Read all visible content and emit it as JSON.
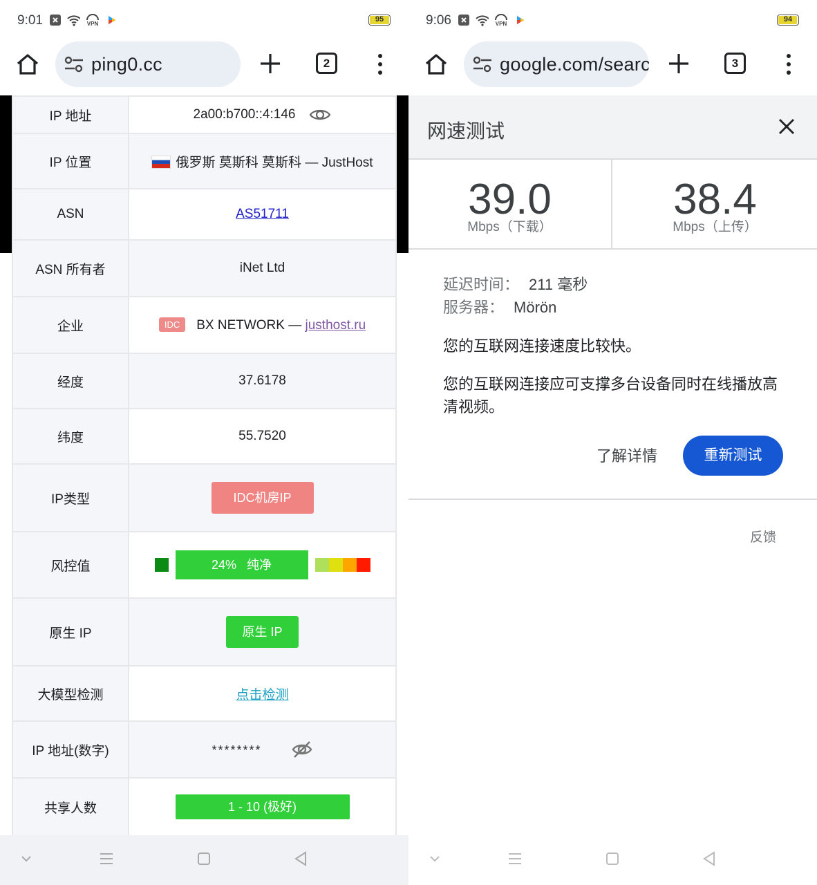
{
  "left": {
    "status": {
      "time": "9:01",
      "vpn": "VPN",
      "battery": "95"
    },
    "toolbar": {
      "url": "ping0.cc",
      "tab_count": "2"
    },
    "rows": [
      {
        "key": "IP 地址",
        "value": "2a00:b700::4:146"
      },
      {
        "key": "IP 位置",
        "value": "俄罗斯 莫斯科 莫斯科 — JustHost"
      },
      {
        "key": "ASN",
        "value": "AS51711"
      },
      {
        "key": "ASN 所有者",
        "value": "iNet Ltd"
      },
      {
        "key": "企业",
        "tag": "IDC",
        "value": "BX NETWORK — ",
        "link": "justhost.ru"
      },
      {
        "key": "经度",
        "value": "37.6178"
      },
      {
        "key": "纬度",
        "value": "55.7520"
      },
      {
        "key": "IP类型",
        "value": "IDC机房IP"
      },
      {
        "key": "风控值",
        "percent": "24%",
        "label": "纯净",
        "risk_fraction": 0.24
      },
      {
        "key": "原生 IP",
        "value": "原生 IP"
      },
      {
        "key": "大模型检测",
        "value": "点击检测"
      },
      {
        "key": "IP 地址(数字)",
        "value": "********"
      },
      {
        "key": "共享人数",
        "value": "1 - 10 (极好)"
      }
    ],
    "risk_scale_colors": [
      "#aee05c",
      "#e0e010",
      "#ffa500",
      "#ff1a00"
    ]
  },
  "right": {
    "status": {
      "time": "9:06",
      "vpn": "VPN",
      "battery": "94"
    },
    "toolbar": {
      "url": "google.com/search",
      "tab_count": "3"
    },
    "panel": {
      "title": "网速测试",
      "download": {
        "value": "39.0",
        "unit": "Mbps（下载）"
      },
      "upload": {
        "value": "38.4",
        "unit": "Mbps（上传）"
      },
      "latency_label": "延迟时间：",
      "latency_value": "211 毫秒",
      "server_label": "服务器：",
      "server_value": "Mörön",
      "message1": "您的互联网连接速度比较快。",
      "message2": "您的互联网连接应可支撑多台设备同时在线播放高清视频。",
      "learn_more": "了解详情",
      "retest": "重新测试",
      "feedback": "反馈"
    }
  },
  "colors": {
    "accent_blue": "#1658d3",
    "green": "#31d03a",
    "red_badge": "#ef8482"
  }
}
